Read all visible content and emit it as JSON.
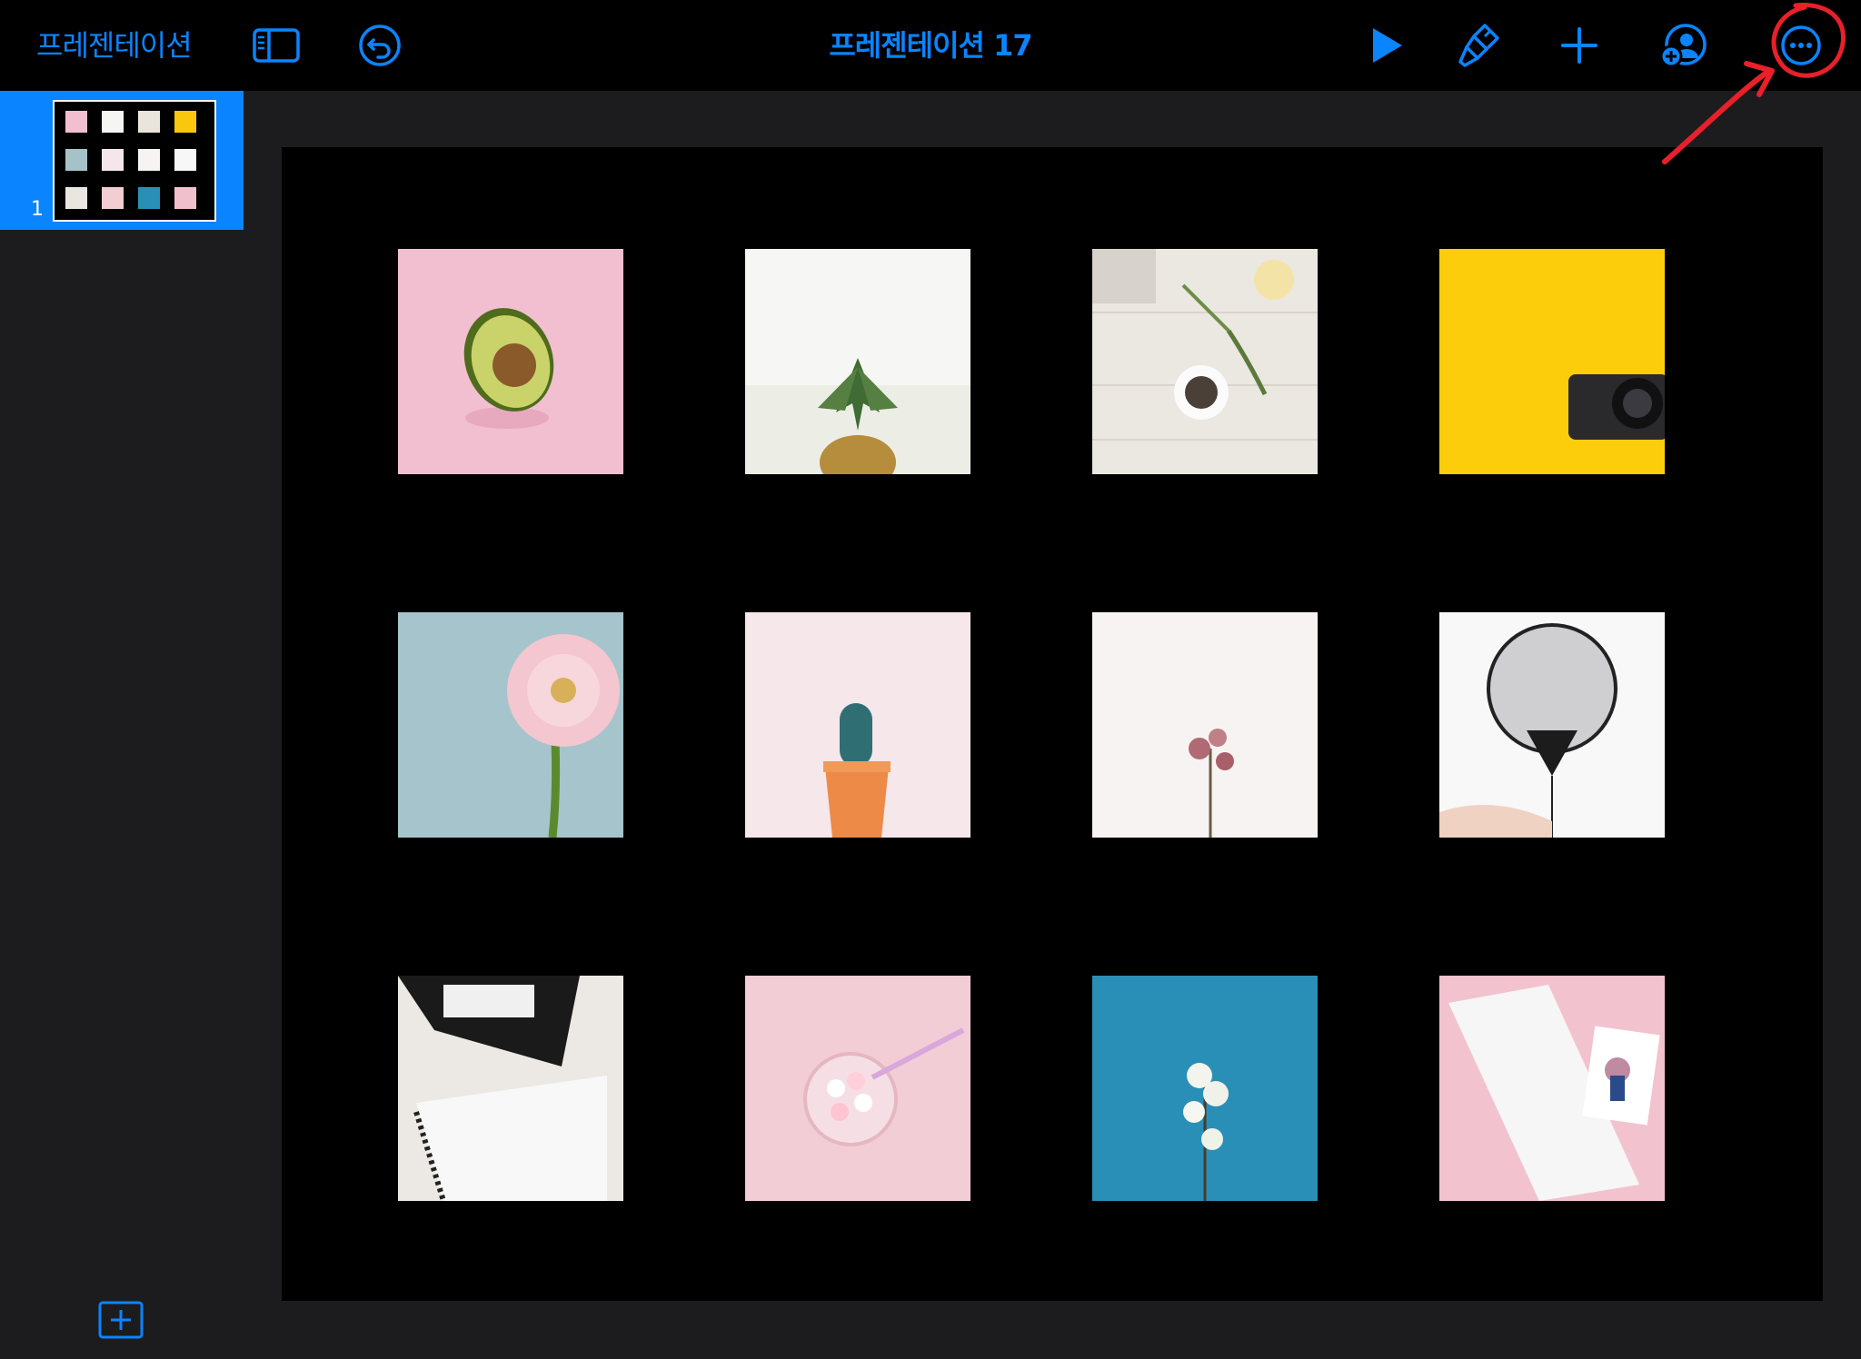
{
  "toolbar": {
    "back_label": "프레젠테이션",
    "document_title": "프레젠테이션 17",
    "icons": [
      "sidebar-toggle-icon",
      "undo-icon",
      "play-icon",
      "format-brush-icon",
      "plus-icon",
      "collaborate-icon",
      "more-icon"
    ]
  },
  "navigator": {
    "slides": [
      {
        "number": "1",
        "selected": true
      }
    ],
    "add_slide_icon": "add-slide-icon"
  },
  "slide": {
    "photos": [
      "avocado",
      "pineapple",
      "herbs-table",
      "camera-yellow",
      "pink-gerbera",
      "cactus-pot",
      "dried-rose",
      "black-balloon",
      "planner-clip",
      "marshmallow-cup",
      "white-blossom",
      "notebook-pink"
    ]
  },
  "colors": {
    "accent": "#0a84ff",
    "toolbar_bg": "#000000",
    "app_bg": "#1c1c1e",
    "annotation": "#e8202a"
  }
}
